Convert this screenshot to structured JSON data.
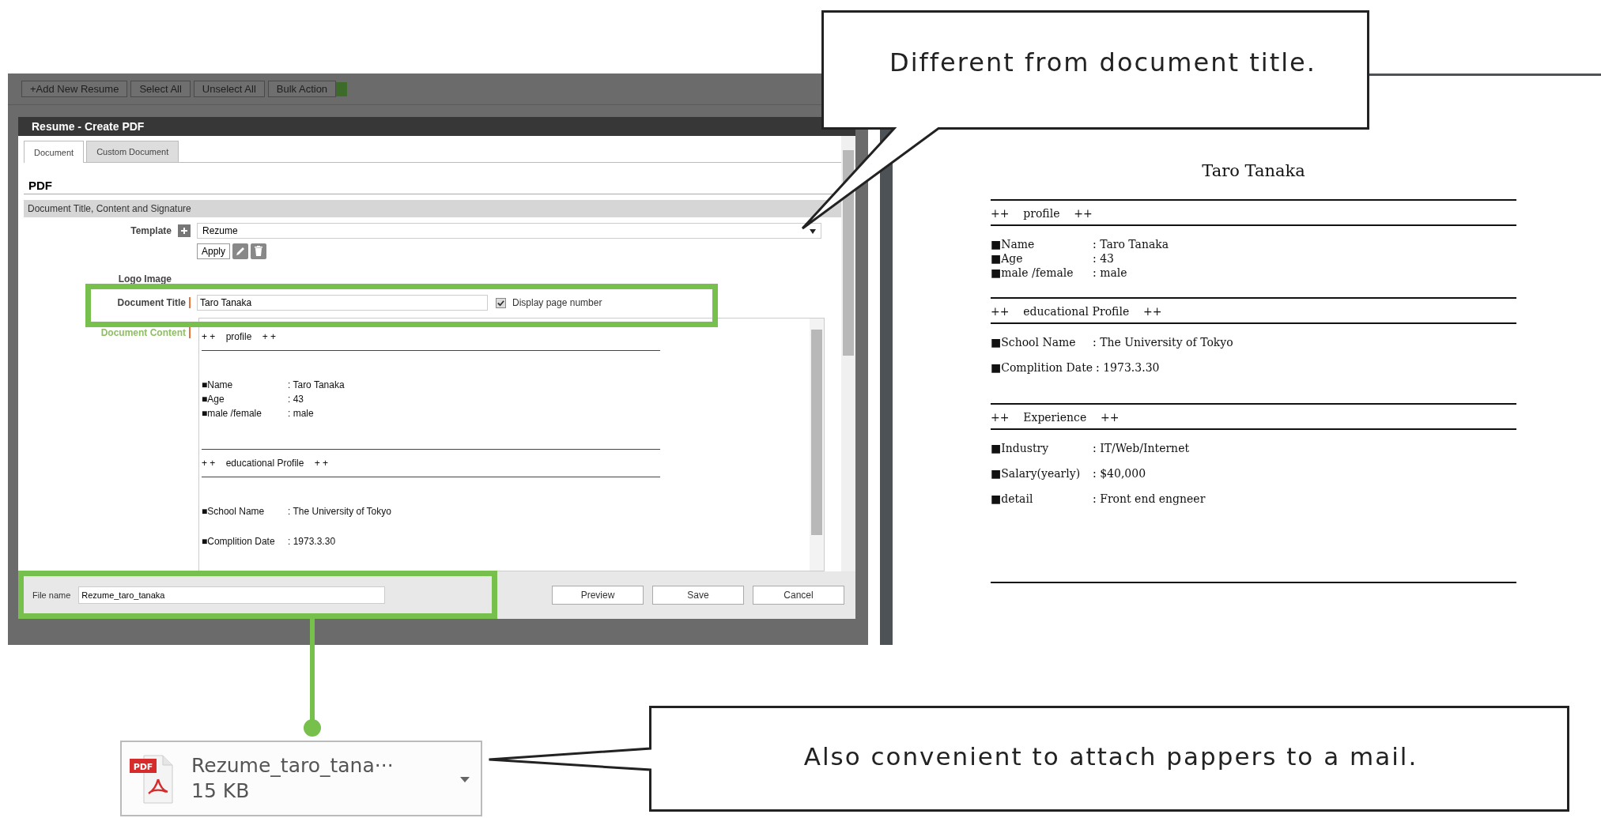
{
  "toolbar": {
    "buttons": [
      "+Add New Resume",
      "Select All",
      "Unselect All",
      "Bulk Action"
    ]
  },
  "dialog": {
    "title": "Resume - Create PDF",
    "tabs": [
      {
        "label": "Document",
        "selected": true
      },
      {
        "label": "Custom Document",
        "selected": false
      }
    ],
    "heading": "PDF",
    "section": "Document Title, Content and Signature",
    "template": {
      "label": "Template",
      "value": "Rezume",
      "apply": "Apply"
    },
    "logo_label": "Logo Image",
    "document_title": {
      "label": "Document Title",
      "value": "Taro Tanaka"
    },
    "page_number": {
      "label": "Display page number",
      "checked": true
    },
    "content_label": "Document Content",
    "editor_sections": [
      {
        "heading": "+ +    profile    + +",
        "items": [
          {
            "label": "■Name",
            "value": ": Taro Tanaka"
          },
          {
            "label": "■Age",
            "value": ": 43"
          },
          {
            "label": "■male /female",
            "value": ": male"
          }
        ]
      },
      {
        "heading": "+ +    educational Profile    + +",
        "items": [
          {
            "label": "■School Name",
            "value": ": The University of Tokyo"
          },
          {
            "label": "■Complition Date",
            "value": ": 1973.3.30"
          }
        ]
      }
    ],
    "file_name": {
      "label": "File name",
      "value": "Rezume_taro_tanaka"
    },
    "buttons": [
      "Preview",
      "Save",
      "Cancel"
    ]
  },
  "preview": {
    "title": "Taro Tanaka",
    "sections": [
      {
        "heading": "++    profile    ++",
        "items": [
          {
            "label": "■Name",
            "value": ": Taro Tanaka"
          },
          {
            "label": "■Age",
            "value": ": 43"
          },
          {
            "label": "■male /female",
            "value": ": male"
          }
        ]
      },
      {
        "heading": "++    educational Profile    ++",
        "items": [
          {
            "label": "■School Name",
            "value": ": The University of Tokyo"
          },
          {
            "label": "■Complition Date",
            "value": ": 1973.3.30"
          }
        ]
      },
      {
        "heading": "++    Experience    ++",
        "items": [
          {
            "label": "■Industry",
            "value": ":  IT/Web/Internet"
          },
          {
            "label": "■Salary(yearly)",
            "value": ":  $40,000"
          },
          {
            "label": "■detail",
            "value": ":  Front end engneer"
          }
        ]
      }
    ]
  },
  "download": {
    "name": "Rezume_taro_tana···",
    "size": "15 KB",
    "icon_label": "PDF"
  },
  "callouts": [
    "Different from document title.",
    "Also convenient to attach pappers to a mail."
  ]
}
